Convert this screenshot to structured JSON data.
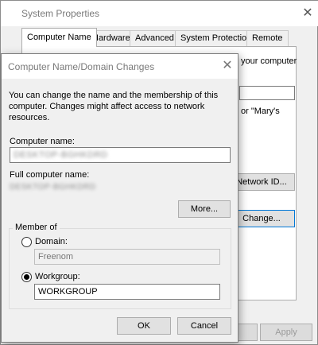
{
  "system_properties": {
    "title": "System Properties",
    "tabs": [
      "Computer Name",
      "Hardware",
      "Advanced",
      "System Protection",
      "Remote"
    ],
    "panel_text_1": "your computer",
    "panel_text_2": "or \"Mary's",
    "network_id_label": "Network ID...",
    "change_label": "Change...",
    "apply_label": "Apply"
  },
  "dialog": {
    "title": "Computer Name/Domain Changes",
    "message": "You can change the name and the membership of this computer. Changes might affect access to network resources.",
    "computer_name_label": "Computer name:",
    "computer_name_value": "DESKTOP-BGHKDRD",
    "full_name_label": "Full computer name:",
    "full_name_value": "DESKTOP-BGHKDRD",
    "more_label": "More...",
    "member_of_label": "Member of",
    "domain_label": "Domain:",
    "domain_value": "Freenom",
    "workgroup_label": "Workgroup:",
    "workgroup_value": "WORKGROUP",
    "selected_membership": "workgroup",
    "ok_label": "OK",
    "cancel_label": "Cancel"
  }
}
